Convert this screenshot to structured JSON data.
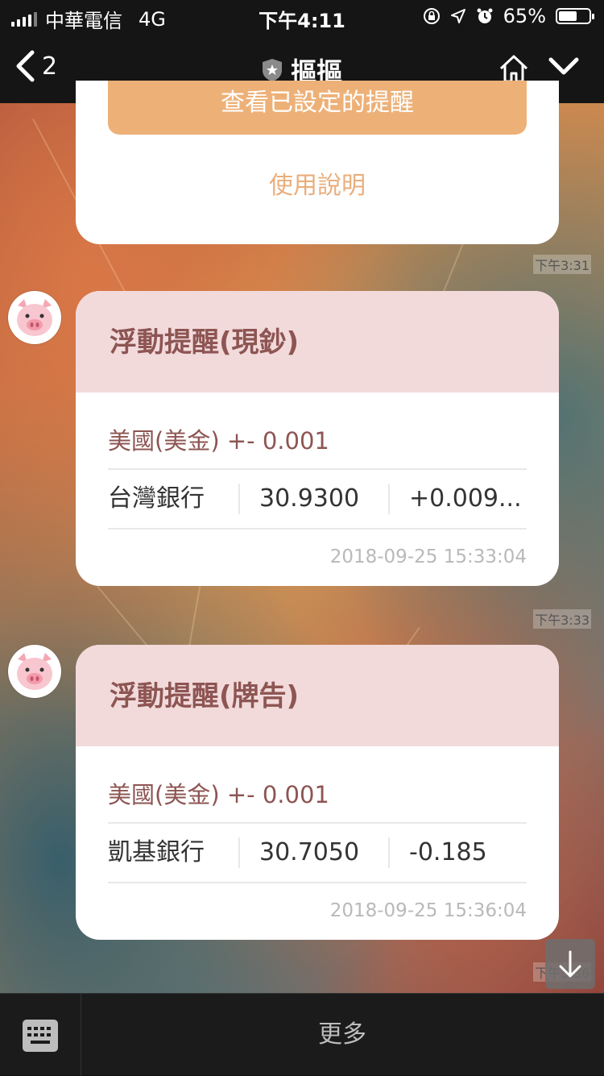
{
  "status_bar": {
    "carrier": "中華電信",
    "network": "4G",
    "time": "下午4:11",
    "battery": "65%",
    "battery_level": 0.65
  },
  "nav": {
    "back_count": "2",
    "title": "摳摳"
  },
  "messages": [
    {
      "button_label": "查看已設定的提醒",
      "help_link": "使用說明",
      "time": "下午3:31"
    },
    {
      "title": "浮動提醒(現鈔)",
      "currency": "美國(美金) +- 0.001",
      "bank": "台灣銀行",
      "rate": "30.9300",
      "change": "+0.009...",
      "timestamp": "2018-09-25 15:33:04",
      "time": "下午3:33"
    },
    {
      "title": "浮動提醒(牌告)",
      "currency": "美國(美金) +- 0.001",
      "bank": "凱基銀行",
      "rate": "30.7050",
      "change": "-0.185",
      "timestamp": "2018-09-25 15:36:04",
      "time": "下午3:36"
    }
  ],
  "bottom_bar": {
    "more_label": "更多"
  },
  "colors": {
    "card_header": "#f2dadb",
    "header_text": "#8d5553",
    "orange_button": "#edb178",
    "help_link": "#e9ae7c"
  }
}
